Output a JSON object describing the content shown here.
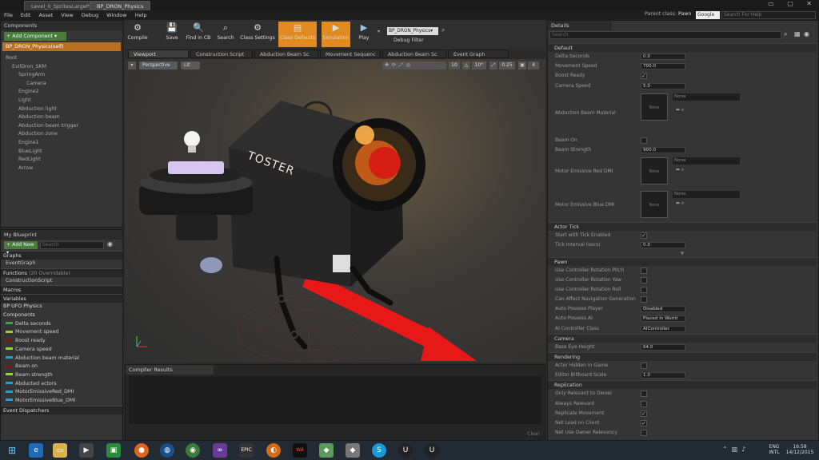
{
  "tabs": [
    "Level_0_SpritesLargeParts_St",
    "BP_DRON_Physics"
  ],
  "menu": [
    "File",
    "Edit",
    "Asset",
    "View",
    "Debug",
    "Window",
    "Help"
  ],
  "parent_class_label": "Parent class:",
  "parent_class": "Pawn",
  "search_engine": "Google",
  "search_help": "Search For Help",
  "components": {
    "title": "Components",
    "add": "+ Add Component ▾",
    "self": "BP_DRON_Physics(self)",
    "tree": [
      "Root",
      "EvilDron_SKM",
      "SpringArm",
      "Camera",
      "Engine2",
      "Light",
      "Abduction light",
      "Abduction beam",
      "Abduction beam trigger",
      "Abduction zone",
      "Engine1",
      "BlueLight",
      "RedLight",
      "Arrow"
    ]
  },
  "myblueprint": {
    "title": "My Blueprint",
    "add": "+ Add New ▾",
    "search": "Search",
    "graphs": "Graphs",
    "eventgraph": "EventGraph",
    "functions": "Functions",
    "overridable": "(20 Overridable)",
    "construction": "ConstructionScript",
    "macros": "Macros",
    "variables": "Variables",
    "category": "BP UFO Physics",
    "comp_label": "Components",
    "vars": [
      {
        "name": "Delta seconds",
        "color": "#3fa34a"
      },
      {
        "name": "Movement speed",
        "color": "#9ad22f"
      },
      {
        "name": "Boost ready",
        "color": "#7a1717"
      },
      {
        "name": "Camera speed",
        "color": "#9ad22f"
      },
      {
        "name": "Abduction beam material",
        "color": "#1aa3d8"
      },
      {
        "name": "Beam on",
        "color": "#7a1717"
      },
      {
        "name": "Beam strength",
        "color": "#9ad22f"
      },
      {
        "name": "Abducted actors",
        "color": "#1aa3d8"
      },
      {
        "name": "MotorEmissiveRed_DMI",
        "color": "#1aa3d8"
      },
      {
        "name": "MotorEmissiveBlue_DMI",
        "color": "#1aa3d8"
      }
    ],
    "dispatchers": "Event Dispatchers"
  },
  "toolbar": {
    "compile": "Compile",
    "save": "Save",
    "findcb": "Find in CB",
    "search": "Search",
    "classsettings": "Class Settings",
    "classdefaults": "Class Defaults",
    "simulation": "Simulation",
    "play": "Play",
    "debugobj": "BP_DRON_Physics▾",
    "debugfilter": "Debug Filter"
  },
  "graphtabs": [
    "Viewport",
    "Construction Script",
    "Abduction Beam Sc",
    "Movement Sequenc",
    "Abduction Beam Sc",
    "Event Graph"
  ],
  "viewport": {
    "perspective": "Perspective",
    "lit": "Lit",
    "snap1": "10",
    "snap2": "10°",
    "snap3": "0.25",
    "snap4": "4",
    "toaster": "TOSTER"
  },
  "compiler": {
    "title": "Compiler Results",
    "clear": "Clear"
  },
  "details": {
    "title": "Details",
    "search": "Search",
    "sec_default": "Default",
    "default": [
      {
        "l": "Delta Seconds",
        "v": "0.0"
      },
      {
        "l": "Movement Speed",
        "v": "700.0"
      },
      {
        "l": "Boost Ready",
        "c": "✓"
      },
      {
        "l": "Camera Speed",
        "v": "5.0"
      }
    ],
    "abd_mat": "Abduction Beam Material",
    "none": "None",
    "beam_on": "Beam On",
    "beam_strength": "Beam Strength",
    "beam_strength_v": "900.0",
    "motor_red": "Motor Emissive Red DMI",
    "motor_blue": "Motor Emissive Blue DMI",
    "sec_tick": "Actor Tick",
    "tick": [
      {
        "l": "Start with Tick Enabled",
        "c": "✓"
      },
      {
        "l": "Tick Interval (secs)",
        "v": "0.0"
      }
    ],
    "sec_pawn": "Pawn",
    "pawn": [
      {
        "l": "Use Controller Rotation Pitch",
        "c": ""
      },
      {
        "l": "Use Controller Rotation Yaw",
        "c": ""
      },
      {
        "l": "Use Controller Rotation Roll",
        "c": ""
      },
      {
        "l": "Can Affect Navigation Generation",
        "c": ""
      },
      {
        "l": "Auto Possess Player",
        "v": "Disabled"
      },
      {
        "l": "Auto Possess AI",
        "v": "Placed in World"
      },
      {
        "l": "AI Controller Class",
        "v": "AIController"
      }
    ],
    "sec_camera": "Camera",
    "camera": [
      {
        "l": "Base Eye Height",
        "v": "64.0"
      }
    ],
    "sec_render": "Rendering",
    "render": [
      {
        "l": "Actor Hidden In Game",
        "c": ""
      },
      {
        "l": "Editor Billboard Scale",
        "v": "1.0"
      }
    ],
    "sec_repl": "Replication",
    "repl": [
      {
        "l": "Only Relevant to Owner",
        "c": ""
      },
      {
        "l": "Always Relevant",
        "c": ""
      },
      {
        "l": "Replicate Movement",
        "c": "✓"
      },
      {
        "l": "Net Load on Client",
        "c": "✓"
      },
      {
        "l": "Net Use Owner Relevancy",
        "c": ""
      }
    ]
  },
  "tray": {
    "lang": "ENG",
    "layout": "INTL",
    "time": "16:58",
    "date": "14/12/2015"
  }
}
